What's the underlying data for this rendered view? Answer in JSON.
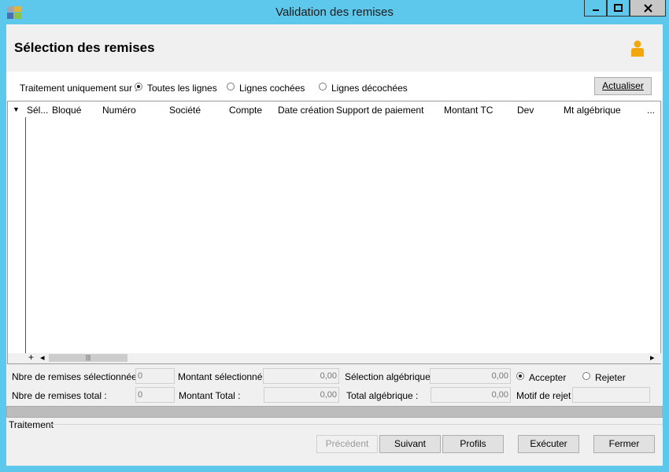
{
  "window": {
    "title": "Validation des remises",
    "min_label": "—",
    "max_label": "☐",
    "close_label": "✕"
  },
  "header": {
    "title": "Sélection des remises"
  },
  "filter": {
    "label": "Traitement uniquement sur :",
    "options": [
      {
        "label": "Toutes les lignes",
        "selected": true
      },
      {
        "label": "Lignes cochées",
        "selected": false
      },
      {
        "label": "Lignes décochées",
        "selected": false
      }
    ],
    "refresh_button": "Actualiser"
  },
  "grid": {
    "sort_indicator": "▼",
    "columns": [
      "Sél...",
      "Bloqué",
      "Numéro",
      "Société",
      "Compte",
      "Date création",
      "Support de paiement",
      "Montant TC",
      "Dev",
      "Mt algébrique",
      "..."
    ],
    "rows": [],
    "footer_add": "+",
    "scroll_left": "◂",
    "scroll_right": "▸",
    "scroll_thumb": "|||"
  },
  "summary": {
    "nb_selected_label": "Nbre de remises sélectionnées :",
    "nb_selected_value": "0",
    "nb_total_label": "Nbre de remises total :",
    "nb_total_value": "0",
    "montant_selected_label": "Montant sélectionné :",
    "montant_selected_value": "0,00",
    "montant_total_label": "Montant Total :",
    "montant_total_value": "0,00",
    "selection_alg_label": "Sélection algébrique :",
    "selection_alg_value": "0,00",
    "total_alg_label": "Total algébrique :",
    "total_alg_value": "0,00",
    "accept_label": "Accepter",
    "accept_selected": true,
    "reject_label": "Rejeter",
    "reject_selected": false,
    "motif_label": "Motif de rejet :",
    "motif_value": ""
  },
  "status": {
    "traitement_label": "Traitement"
  },
  "buttons": {
    "precedent": "Précédent",
    "suivant": "Suivant",
    "profils": "Profils",
    "executer": "Exécuter",
    "fermer": "Fermer"
  },
  "colors": {
    "titlebar": "#5ec8ec",
    "client": "#f0f0f0",
    "user_icon": "#f2a70f"
  }
}
